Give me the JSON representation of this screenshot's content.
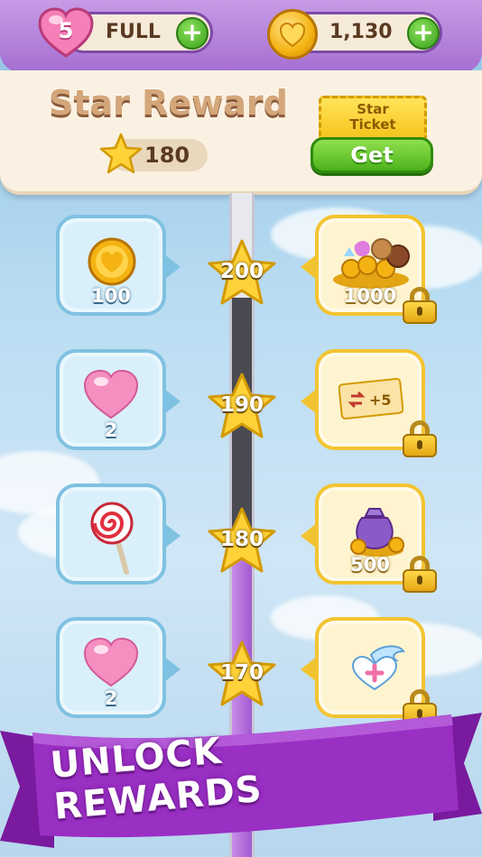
{
  "header": {
    "lives_count": "5",
    "lives_status": "FULL",
    "coins": "1,130"
  },
  "star_reward": {
    "title": "Star Reward",
    "star_count": "180",
    "ticket_label_line1": "Star",
    "ticket_label_line2": "Ticket",
    "get_label": "Get"
  },
  "milestones": [
    {
      "stars": "200",
      "free_value": "100",
      "free_icon": "coin-icon",
      "premium_value": "1000",
      "premium_icon": "treasure-pile-icon",
      "locked": true
    },
    {
      "stars": "190",
      "free_value": "2",
      "free_icon": "heart-icon",
      "premium_value": "",
      "premium_icon": "swap-ticket-plus5-icon",
      "locked": true
    },
    {
      "stars": "180",
      "free_value": "",
      "free_icon": "lollipop-icon",
      "premium_value": "500",
      "premium_icon": "coin-bag-icon",
      "locked": true
    },
    {
      "stars": "170",
      "free_value": "2",
      "free_icon": "heart-icon",
      "premium_value": "",
      "premium_icon": "winged-heart-plus-icon",
      "locked": true
    }
  ],
  "ticket_plus_label": "+5",
  "banner_text": "UNLOCK REWARDS",
  "colors": {
    "header_purple": "#a56fd1",
    "panel_cream": "#fbf1e2",
    "free_box_border": "#7fc1e1",
    "premium_box_border": "#f3c431",
    "get_button_green": "#4db21c",
    "ribbon_purple": "#9a2fc4"
  }
}
